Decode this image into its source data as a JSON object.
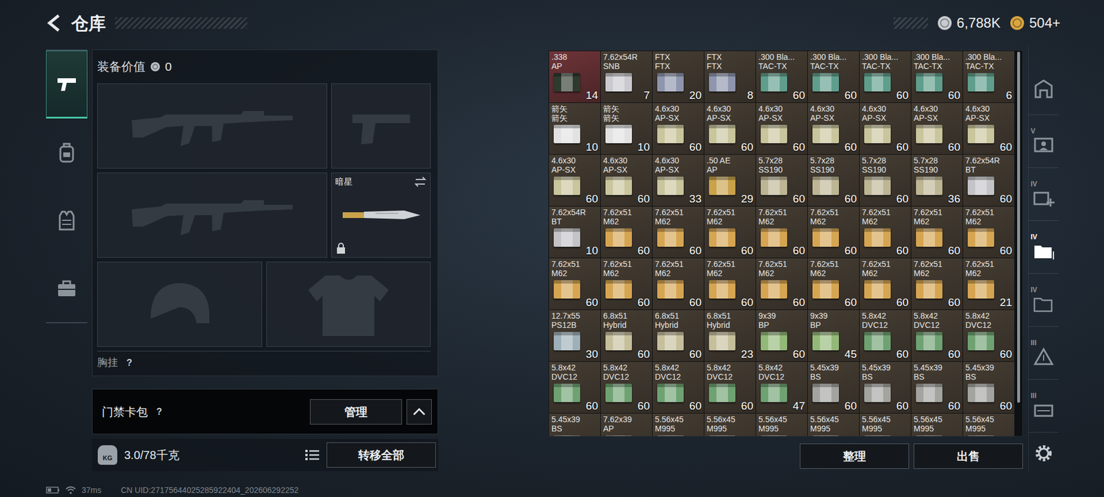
{
  "header": {
    "title": "仓库"
  },
  "currencies": [
    {
      "value": "6,788K",
      "color": "#c8ccd0"
    },
    {
      "value": "504+",
      "color": "#d9a640"
    }
  ],
  "side_tabs": [
    {
      "selected": true
    },
    {
      "selected": false
    },
    {
      "selected": false
    },
    {
      "selected": false
    }
  ],
  "loadout": {
    "value_label": "装备价值",
    "value": "0",
    "slots": [
      {
        "kind": "rifle"
      },
      {
        "kind": "pistol"
      },
      {
        "kind": "rifle"
      },
      {
        "kind": "melee",
        "label": "暗星",
        "locked": true
      },
      {
        "kind": "helmet"
      },
      {
        "kind": "armor"
      }
    ],
    "section": {
      "label": "胸挂",
      "help": "?"
    }
  },
  "keycard": {
    "label": "门禁卡包",
    "help": "?",
    "button": "管理"
  },
  "weight": {
    "icon_label": "KG",
    "value": "3.0/78千克",
    "button": "转移全部"
  },
  "stash": {
    "items": [
      {
        "name": ".338",
        "sub": "AP",
        "count": "14",
        "color": "#2f3a2e",
        "highlight": true
      },
      {
        "name": "7.62x54R",
        "sub": "SNB",
        "count": "7",
        "color": "#c9c9cf",
        "highlight": false
      },
      {
        "name": "FTX",
        "sub": "FTX",
        "count": "20",
        "color": "#8e95ad",
        "highlight": false
      },
      {
        "name": "FTX",
        "sub": "FTX",
        "count": "8",
        "color": "#8e95ad",
        "highlight": false
      },
      {
        "name": ".300 Bla...",
        "sub": "TAC-TX",
        "count": "60",
        "color": "#5f9e8c",
        "highlight": false
      },
      {
        "name": ".300 Bla...",
        "sub": "TAC-TX",
        "count": "60",
        "color": "#5f9e8c",
        "highlight": false
      },
      {
        "name": ".300 Bla...",
        "sub": "TAC-TX",
        "count": "60",
        "color": "#5f9e8c",
        "highlight": false
      },
      {
        "name": ".300 Bla...",
        "sub": "TAC-TX",
        "count": "60",
        "color": "#5f9e8c",
        "highlight": false
      },
      {
        "name": ".300 Bla...",
        "sub": "TAC-TX",
        "count": "6",
        "color": "#5f9e8c",
        "highlight": false
      },
      {
        "name": "箭矢",
        "sub": "箭矢",
        "count": "10",
        "color": "#e2e2e2",
        "highlight": false
      },
      {
        "name": "箭矢",
        "sub": "箭矢",
        "count": "10",
        "color": "#e2e2e2",
        "highlight": false
      },
      {
        "name": "4.6x30",
        "sub": "AP-SX",
        "count": "60",
        "color": "#c9c59c",
        "highlight": false
      },
      {
        "name": "4.6x30",
        "sub": "AP-SX",
        "count": "60",
        "color": "#c9c59c",
        "highlight": false
      },
      {
        "name": "4.6x30",
        "sub": "AP-SX",
        "count": "60",
        "color": "#c9c59c",
        "highlight": false
      },
      {
        "name": "4.6x30",
        "sub": "AP-SX",
        "count": "60",
        "color": "#c9c59c",
        "highlight": false
      },
      {
        "name": "4.6x30",
        "sub": "AP-SX",
        "count": "60",
        "color": "#c9c59c",
        "highlight": false
      },
      {
        "name": "4.6x30",
        "sub": "AP-SX",
        "count": "60",
        "color": "#c9c59c",
        "highlight": false
      },
      {
        "name": "4.6x30",
        "sub": "AP-SX",
        "count": "60",
        "color": "#c9c59c",
        "highlight": false
      },
      {
        "name": "4.6x30",
        "sub": "AP-SX",
        "count": "60",
        "color": "#c9c59c",
        "highlight": false
      },
      {
        "name": "4.6x30",
        "sub": "AP-SX",
        "count": "60",
        "color": "#c9c59c",
        "highlight": false
      },
      {
        "name": "4.6x30",
        "sub": "AP-SX",
        "count": "33",
        "color": "#c9c59c",
        "highlight": false
      },
      {
        "name": ".50 AE",
        "sub": "AP",
        "count": "29",
        "color": "#c9a24a",
        "highlight": false
      },
      {
        "name": "5.7x28",
        "sub": "SS190",
        "count": "60",
        "color": "#bdb594",
        "highlight": false
      },
      {
        "name": "5.7x28",
        "sub": "SS190",
        "count": "60",
        "color": "#bdb594",
        "highlight": false
      },
      {
        "name": "5.7x28",
        "sub": "SS190",
        "count": "60",
        "color": "#bdb594",
        "highlight": false
      },
      {
        "name": "5.7x28",
        "sub": "SS190",
        "count": "36",
        "color": "#bdb594",
        "highlight": false
      },
      {
        "name": "7.62x54R",
        "sub": "BT",
        "count": "60",
        "color": "#c4c4c8",
        "highlight": false
      },
      {
        "name": "7.62x54R",
        "sub": "BT",
        "count": "10",
        "color": "#c4c4c8",
        "highlight": false
      },
      {
        "name": "7.62x51",
        "sub": "M62",
        "count": "60",
        "color": "#d6a552",
        "highlight": false
      },
      {
        "name": "7.62x51",
        "sub": "M62",
        "count": "60",
        "color": "#d6a552",
        "highlight": false
      },
      {
        "name": "7.62x51",
        "sub": "M62",
        "count": "60",
        "color": "#d6a552",
        "highlight": false
      },
      {
        "name": "7.62x51",
        "sub": "M62",
        "count": "60",
        "color": "#d6a552",
        "highlight": false
      },
      {
        "name": "7.62x51",
        "sub": "M62",
        "count": "60",
        "color": "#d6a552",
        "highlight": false
      },
      {
        "name": "7.62x51",
        "sub": "M62",
        "count": "60",
        "color": "#d6a552",
        "highlight": false
      },
      {
        "name": "7.62x51",
        "sub": "M62",
        "count": "60",
        "color": "#d6a552",
        "highlight": false
      },
      {
        "name": "7.62x51",
        "sub": "M62",
        "count": "60",
        "color": "#d6a552",
        "highlight": false
      },
      {
        "name": "7.62x51",
        "sub": "M62",
        "count": "60",
        "color": "#d6a552",
        "highlight": false
      },
      {
        "name": "7.62x51",
        "sub": "M62",
        "count": "60",
        "color": "#d6a552",
        "highlight": false
      },
      {
        "name": "7.62x51",
        "sub": "M62",
        "count": "60",
        "color": "#d6a552",
        "highlight": false
      },
      {
        "name": "7.62x51",
        "sub": "M62",
        "count": "60",
        "color": "#d6a552",
        "highlight": false
      },
      {
        "name": "7.62x51",
        "sub": "M62",
        "count": "60",
        "color": "#d6a552",
        "highlight": false
      },
      {
        "name": "7.62x51",
        "sub": "M62",
        "count": "60",
        "color": "#d6a552",
        "highlight": false
      },
      {
        "name": "7.62x51",
        "sub": "M62",
        "count": "60",
        "color": "#d6a552",
        "highlight": false
      },
      {
        "name": "7.62x51",
        "sub": "M62",
        "count": "60",
        "color": "#d6a552",
        "highlight": false
      },
      {
        "name": "7.62x51",
        "sub": "M62",
        "count": "21",
        "color": "#d6a552",
        "highlight": false
      },
      {
        "name": "12.7x55",
        "sub": "PS12B",
        "count": "30",
        "color": "#9eb0b8",
        "highlight": false
      },
      {
        "name": "6.8x51",
        "sub": "Hybrid",
        "count": "60",
        "color": "#c6bf9c",
        "highlight": false
      },
      {
        "name": "6.8x51",
        "sub": "Hybrid",
        "count": "60",
        "color": "#c6bf9c",
        "highlight": false
      },
      {
        "name": "6.8x51",
        "sub": "Hybrid",
        "count": "23",
        "color": "#c6bf9c",
        "highlight": false
      },
      {
        "name": "9x39",
        "sub": "BP",
        "count": "60",
        "color": "#93b978",
        "highlight": false
      },
      {
        "name": "9x39",
        "sub": "BP",
        "count": "45",
        "color": "#93b978",
        "highlight": false
      },
      {
        "name": "5.8x42",
        "sub": "DVC12",
        "count": "60",
        "color": "#6fa272",
        "highlight": false
      },
      {
        "name": "5.8x42",
        "sub": "DVC12",
        "count": "60",
        "color": "#6fa272",
        "highlight": false
      },
      {
        "name": "5.8x42",
        "sub": "DVC12",
        "count": "60",
        "color": "#6fa272",
        "highlight": false
      },
      {
        "name": "5.8x42",
        "sub": "DVC12",
        "count": "60",
        "color": "#6fa272",
        "highlight": false
      },
      {
        "name": "5.8x42",
        "sub": "DVC12",
        "count": "60",
        "color": "#6fa272",
        "highlight": false
      },
      {
        "name": "5.8x42",
        "sub": "DVC12",
        "count": "60",
        "color": "#6fa272",
        "highlight": false
      },
      {
        "name": "5.8x42",
        "sub": "DVC12",
        "count": "60",
        "color": "#6fa272",
        "highlight": false
      },
      {
        "name": "5.8x42",
        "sub": "DVC12",
        "count": "47",
        "color": "#6fa272",
        "highlight": false
      },
      {
        "name": "5.45x39",
        "sub": "BS",
        "count": "60",
        "color": "#a3a39f",
        "highlight": false
      },
      {
        "name": "5.45x39",
        "sub": "BS",
        "count": "60",
        "color": "#a3a39f",
        "highlight": false
      },
      {
        "name": "5.45x39",
        "sub": "BS",
        "count": "60",
        "color": "#a3a39f",
        "highlight": false
      },
      {
        "name": "5.45x39",
        "sub": "BS",
        "count": "60",
        "color": "#a3a39f",
        "highlight": false
      },
      {
        "name": "5.45x39",
        "sub": "BS",
        "color": "#a3a39f",
        "highlight": false
      },
      {
        "name": "7.62x39",
        "sub": "AP",
        "color": "#a8a090",
        "highlight": false
      },
      {
        "name": "5.56x45",
        "sub": "M995",
        "color": "#b9b2a2",
        "highlight": false
      },
      {
        "name": "5.56x45",
        "sub": "M995",
        "color": "#b9b2a2",
        "highlight": false
      },
      {
        "name": "5.56x45",
        "sub": "M995",
        "color": "#b9b2a2",
        "highlight": false
      },
      {
        "name": "5.56x45",
        "sub": "M995",
        "color": "#b9b2a2",
        "highlight": false
      },
      {
        "name": "5.56x45",
        "sub": "M995",
        "color": "#b9b2a2",
        "highlight": false
      },
      {
        "name": "5.56x45",
        "sub": "M995",
        "color": "#b9b2a2",
        "highlight": false
      },
      {
        "name": "5.56x45",
        "sub": "M995",
        "color": "#b9b2a2",
        "highlight": false
      }
    ],
    "buttons": [
      "整理",
      "出售"
    ]
  },
  "side_tools": [
    {
      "selected": false
    },
    {
      "label": "V",
      "selected": false
    },
    {
      "label": "IV",
      "selected": false
    },
    {
      "label": "IV",
      "selected": true
    },
    {
      "label": "IV",
      "selected": false
    },
    {
      "label": "III",
      "selected": false
    },
    {
      "label": "III",
      "selected": false
    }
  ],
  "status": {
    "ping": "37ms",
    "uid": "CN UID:27175644025285922404_202606292252"
  }
}
